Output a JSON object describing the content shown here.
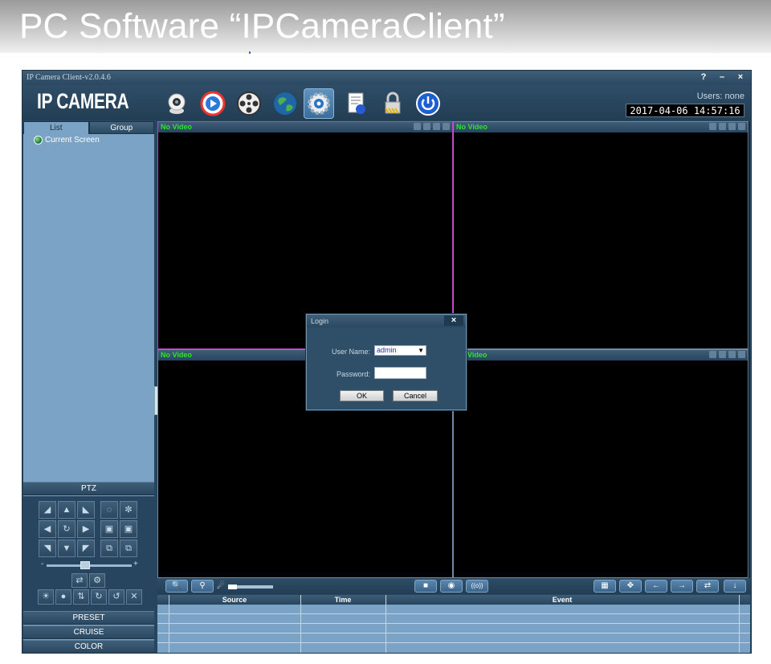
{
  "banner": {
    "title": "PC Software “IPCameraClient”"
  },
  "window": {
    "title": "IP Camera Client-v2.0.4.6",
    "controls": [
      "?",
      "–",
      "×"
    ],
    "logo": "IP CAMERA",
    "users_label": "Users: none",
    "clock": "2017-04-06 14:57:16",
    "toolbar_icons": [
      "camera-icon",
      "play-icon",
      "film-reel-icon",
      "globe-icon",
      "settings-gear-icon",
      "log-document-icon",
      "lock-icon",
      "power-icon"
    ]
  },
  "sidebar": {
    "tabs": [
      "List",
      "Group"
    ],
    "tree": [
      {
        "label": "Current Screen"
      }
    ],
    "ptz_header": "PTZ",
    "ptz_slider": {
      "value": 0.45
    },
    "sections": [
      "PRESET",
      "CRUISE",
      "COLOR"
    ]
  },
  "video": {
    "cells": [
      {
        "status": "No Video",
        "selected": true
      },
      {
        "status": "No Video",
        "selected": false
      },
      {
        "status": "No Video",
        "selected": false
      },
      {
        "status": "Video",
        "selected": false
      }
    ]
  },
  "bottom_bar": {
    "volume": 0.2
  },
  "events": {
    "columns": [
      "Source",
      "Time",
      "Event"
    ],
    "rows": 7
  },
  "login": {
    "title": "Login",
    "close": "×",
    "username_label": "User Name:",
    "username_value": "admin",
    "password_label": "Password:",
    "ok": "OK",
    "cancel": "Cancel"
  },
  "colors": {
    "accent": "#27455e",
    "panel": "#7ba3c6",
    "video_ok": "#2ce62c",
    "selected_border": "#c040c8"
  }
}
